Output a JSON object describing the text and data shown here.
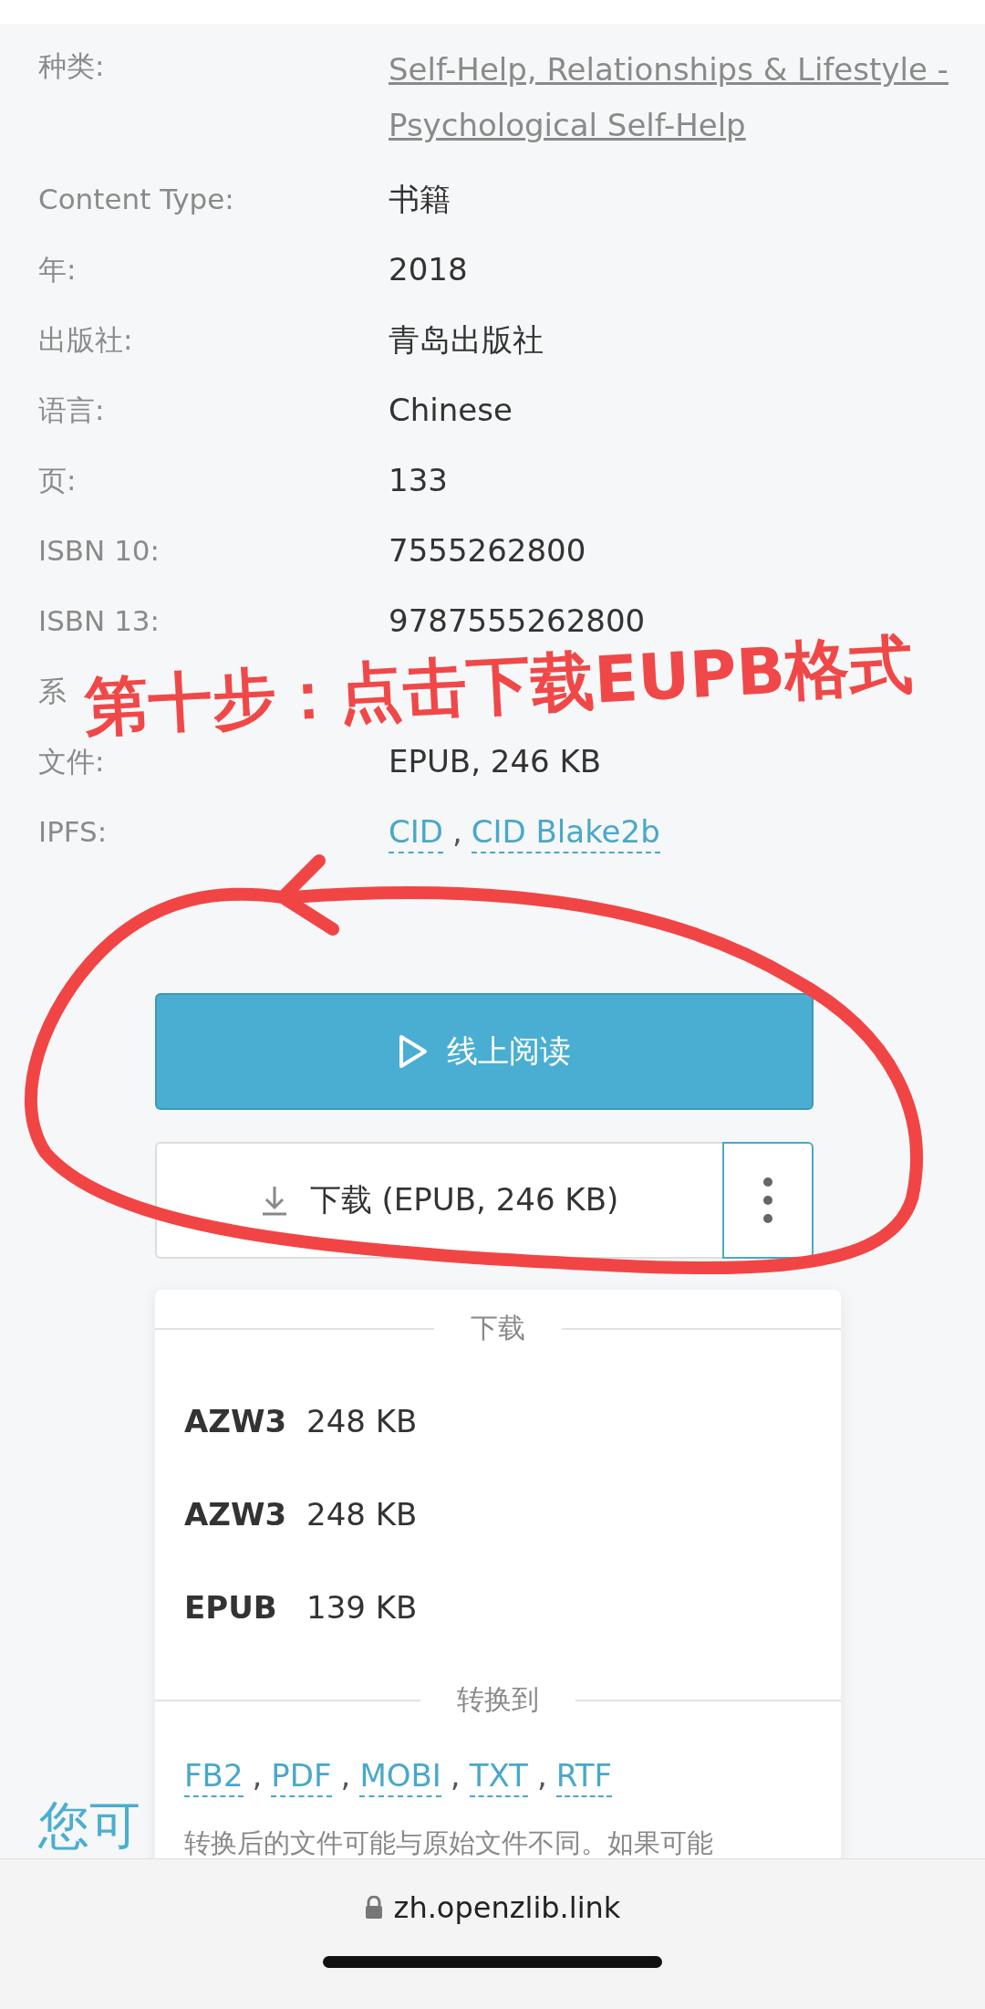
{
  "details": [
    {
      "label": "种类:",
      "value": "Self-Help, Relationships & Lifestyle - Psychological Self-Help",
      "kind": "link"
    },
    {
      "label": "Content Type:",
      "value": "书籍",
      "kind": "text"
    },
    {
      "label": "年:",
      "value": "2018",
      "kind": "text"
    },
    {
      "label": "出版社:",
      "value": "青岛出版社",
      "kind": "text"
    },
    {
      "label": "语言:",
      "value": "Chinese",
      "kind": "text"
    },
    {
      "label": "页:",
      "value": "133",
      "kind": "text"
    },
    {
      "label": "ISBN 10:",
      "value": "7555262800",
      "kind": "text"
    },
    {
      "label": "ISBN 13:",
      "value": "9787555262800",
      "kind": "text"
    },
    {
      "label": "系",
      "kind": "covered"
    },
    {
      "label": "文件:",
      "value": "EPUB, 246 KB",
      "kind": "text"
    },
    {
      "label": "IPFS:",
      "links": [
        "CID",
        "CID Blake2b"
      ],
      "separator": ",",
      "kind": "links"
    }
  ],
  "read_button": "线上阅读",
  "download_button": "下载 (EPUB, 246 KB)",
  "dropdown": {
    "download_heading": "下载",
    "formats": [
      {
        "format": "AZW3",
        "size": "248 KB"
      },
      {
        "format": "AZW3",
        "size": "248 KB"
      },
      {
        "format": "EPUB",
        "size": "139 KB"
      }
    ],
    "convert_heading": "转换到",
    "convert_links": [
      "FB2",
      "PDF",
      "MOBI",
      "TXT",
      "RTF"
    ],
    "separator": ",",
    "note": "转换后的文件可能与原始文件不同。如果可能"
  },
  "section_heading": "您可",
  "annotation": {
    "text": "第十步：点击下载EUPB格式"
  },
  "address_bar": {
    "url": "zh.openzlib.link"
  }
}
